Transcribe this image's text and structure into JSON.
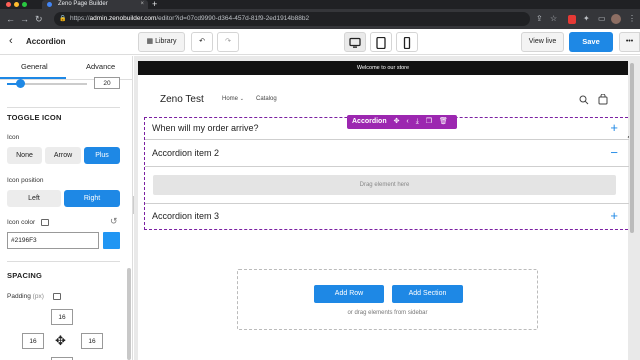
{
  "browser": {
    "tab_title": "Zeno Page Builder",
    "tab_close": "×",
    "new_tab": "+",
    "url_host": "admin.zenobuilder.com",
    "url_prefix": "https://",
    "url_path": "/editor?id=07cd9990-d364-457d-81f9-2ed1914b88b2",
    "colors": {
      "close": "#ff5f57",
      "minimize": "#febc2e",
      "maximize": "#28c840"
    }
  },
  "editor": {
    "back_icon": "chevron-left-icon",
    "title": "Accordion",
    "library_label": "Library",
    "view_live_label": "View live",
    "save_label": "Save",
    "more_label": "•••",
    "undo_glyph": "↶",
    "redo_glyph": "↷",
    "accent": "#1e88e5"
  },
  "sidebar": {
    "tabs": [
      "General",
      "Advance"
    ],
    "top_value": "20",
    "toggle_icon": {
      "heading": "TOGGLE ICON",
      "icon_label": "Icon",
      "icon_options": [
        "None",
        "Arrow",
        "Plus"
      ],
      "icon_selected": "Plus",
      "position_label": "Icon position",
      "position_options": [
        "Left",
        "Right"
      ],
      "position_selected": "Right",
      "color_label": "Icon color",
      "color_value": "#2196F3"
    },
    "spacing": {
      "heading": "SPACING",
      "padding_label": "Padding",
      "padding_unit": "(px)",
      "top": "16",
      "left": "16",
      "right": "16"
    }
  },
  "page": {
    "announcement": "Welcome to our store",
    "logo": "Zeno Test",
    "nav": [
      "Home",
      "Catalog"
    ],
    "accordion": {
      "badge_label": "Accordion",
      "items": [
        {
          "title": "When will my order arrive?",
          "icon": "+"
        },
        {
          "title": "Accordion item 2",
          "icon": "−"
        },
        {
          "title": "Accordion item 3",
          "icon": "+"
        }
      ],
      "drag_hint": "Drag element here"
    },
    "dropzone": {
      "add_row": "Add Row",
      "add_section": "Add Section",
      "hint": "or drag elements from sidebar"
    }
  }
}
